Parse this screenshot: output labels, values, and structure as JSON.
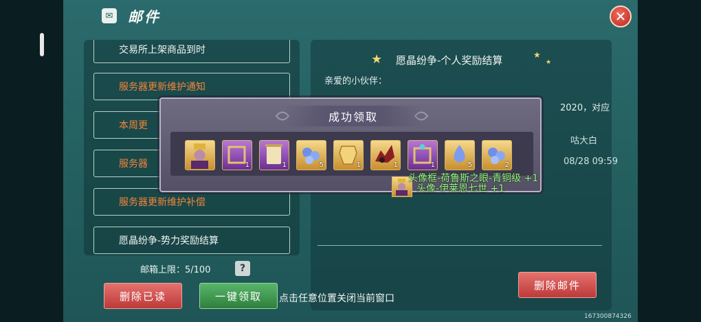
{
  "window": {
    "title": "邮件",
    "close_label": "✕"
  },
  "mail_list": {
    "items": [
      {
        "label": "交易所上架商品到时",
        "state": "read"
      },
      {
        "label": "服务器更新维护通知",
        "state": "unread"
      },
      {
        "label": "本周更",
        "state": "unread"
      },
      {
        "label": "服务器",
        "state": "unread"
      },
      {
        "label": "服务器更新维护补偿",
        "state": "unread"
      },
      {
        "label": "愿晶纷争-势力奖励结算",
        "state": "read"
      }
    ],
    "limit_text": "邮箱上限：5/100",
    "help_label": "?"
  },
  "buttons": {
    "delete_read": "删除已读",
    "claim_all": "一键领取",
    "delete_mail": "删除邮件"
  },
  "detail": {
    "title": "愿晶纷争-个人奖励结算",
    "greeting": "亲爱的小伙伴：",
    "body_tail": "2020，对应",
    "sender": "咕大白",
    "date": "08/28 09:59"
  },
  "reward_dialog": {
    "title": "成功领取",
    "items": [
      {
        "icon": "avatar-icon",
        "kind": "gold",
        "qty": ""
      },
      {
        "icon": "frame-icon",
        "kind": "purple",
        "qty": "1"
      },
      {
        "icon": "scroll-icon",
        "kind": "purple",
        "qty": "1"
      },
      {
        "icon": "crystal-cluster-icon",
        "kind": "gold",
        "qty": "5"
      },
      {
        "icon": "armor-icon",
        "kind": "gold",
        "qty": "1"
      },
      {
        "icon": "dragon-icon",
        "kind": "gold",
        "qty": "1"
      },
      {
        "icon": "frame-icon",
        "kind": "purple",
        "qty": "1"
      },
      {
        "icon": "crystal-drop-icon",
        "kind": "gold",
        "qty": "5"
      },
      {
        "icon": "crystal-cluster-icon",
        "kind": "gold",
        "qty": "2"
      }
    ],
    "float_lines": [
      "头像框-荷鲁斯之眼-青铜级 +1",
      "头像-伊莱恩七世 +1"
    ]
  },
  "hint": "点击任意位置关闭当前窗口",
  "uid": "167300874326",
  "colors": {
    "accent_gold": "#d8b46a",
    "unread_orange": "#f3843b",
    "float_green": "#9ef58d"
  }
}
